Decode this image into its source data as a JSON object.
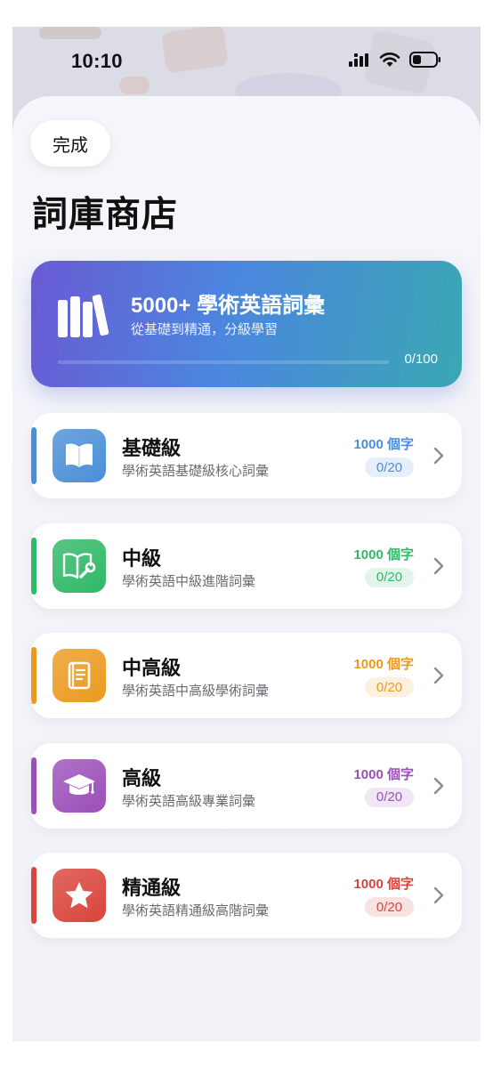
{
  "status_bar": {
    "time": "10:10"
  },
  "header": {
    "done_label": "完成",
    "title": "詞庫商店"
  },
  "hero": {
    "title": "5000+ 學術英語詞彙",
    "subtitle": "從基礎到精通，分級學習",
    "progress_text": "0/100",
    "progress_fraction": 0,
    "gradient": [
      "#6a5ad4",
      "#4b86df",
      "#3aa7b3"
    ]
  },
  "levels": [
    {
      "name": "基礎級",
      "description": "學術英語基礎級核心詞彙",
      "count": "1000 個字",
      "progress": "0/20",
      "color": "#4a8fd6",
      "badge_bg": "#e6eff9",
      "icon": "open-book-icon"
    },
    {
      "name": "中級",
      "description": "學術英語中級進階詞彙",
      "count": "1000 個字",
      "progress": "0/20",
      "color": "#2fb866",
      "badge_bg": "#e3f5ea",
      "icon": "book-wrench-icon"
    },
    {
      "name": "中高級",
      "description": "學術英語中高級學術詞彙",
      "count": "1000 個字",
      "progress": "0/20",
      "color": "#eb9a1f",
      "badge_bg": "#fcf0de",
      "icon": "closed-book-icon"
    },
    {
      "name": "高級",
      "description": "學術英語高級專業詞彙",
      "count": "1000 個字",
      "progress": "0/20",
      "color": "#9b4fb8",
      "badge_bg": "#f1e6f6",
      "icon": "graduation-cap-icon"
    },
    {
      "name": "精通級",
      "description": "學術英語精通級高階詞彙",
      "count": "1000 個字",
      "progress": "0/20",
      "color": "#d9443b",
      "badge_bg": "#f9e3e2",
      "icon": "star-icon"
    }
  ]
}
